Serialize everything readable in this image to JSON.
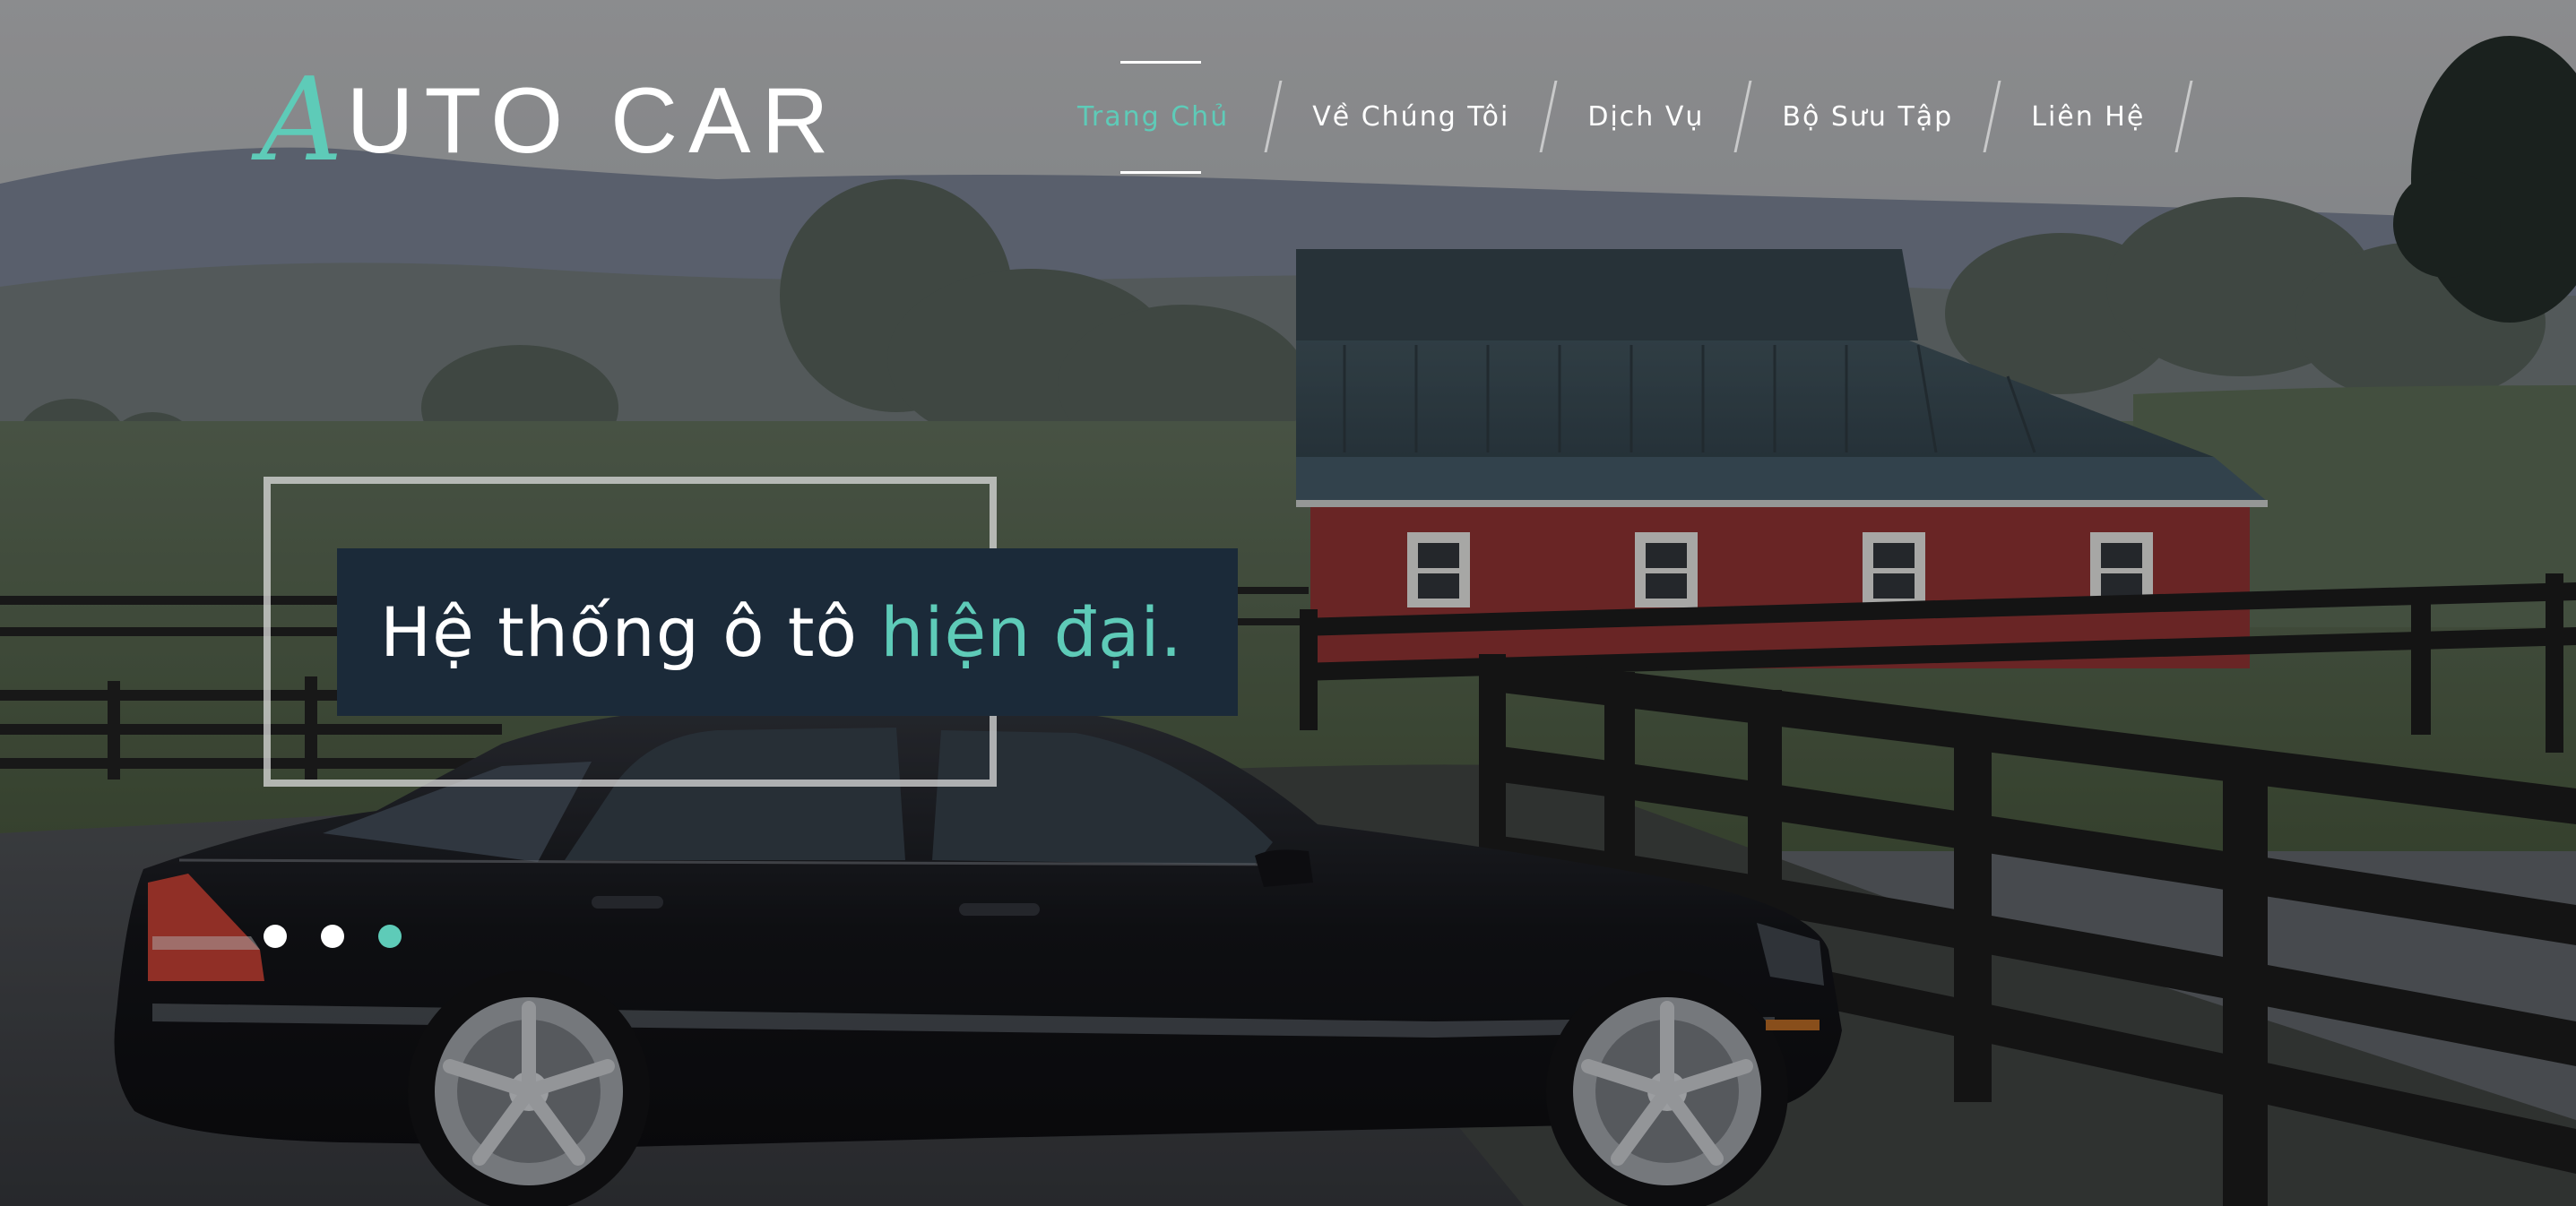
{
  "brand": {
    "logo_initial": "A",
    "logo_rest": "UTO CAR",
    "accent_color": "#5ecbb8"
  },
  "nav": {
    "items": [
      {
        "label": "Trang Chủ",
        "active": true
      },
      {
        "label": "Về Chúng Tôi",
        "active": false
      },
      {
        "label": "Dịch Vụ",
        "active": false
      },
      {
        "label": "Bộ Sưu Tập",
        "active": false
      },
      {
        "label": "Liên Hệ",
        "active": false
      }
    ]
  },
  "hero": {
    "headline_main": "Hệ thống ô tô ",
    "headline_accent": "hiện đại.",
    "headline_box_color": "#1b2a39",
    "slides": {
      "count": 3,
      "active_index": 2
    }
  }
}
